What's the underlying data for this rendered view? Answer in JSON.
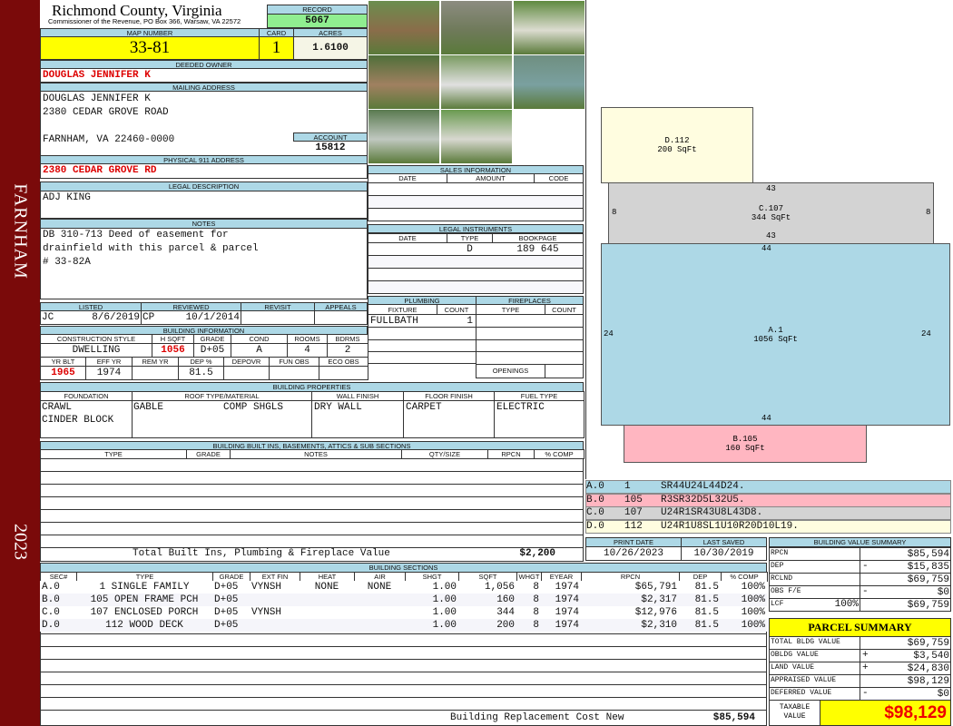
{
  "sidebar": {
    "city": "FARNHAM",
    "year": "2023",
    "color": "#7a0a0a"
  },
  "header": {
    "title": "Richmond County, Virginia",
    "subtitle": "Commissioner of the Revenue, PO Box 366, Warsaw, VA 22572",
    "record_label": "RECORD",
    "record": "5067"
  },
  "parcel": {
    "map_label": "MAP NUMBER",
    "map": "33-81",
    "card_label": "CARD",
    "card": "1",
    "acres_label": "ACRES",
    "acres": "1.6100"
  },
  "owner": {
    "label": "DEEDED OWNER",
    "name": "DOUGLAS JENNIFER K"
  },
  "mailing": {
    "label": "MAILING ADDRESS",
    "lines": [
      "DOUGLAS JENNIFER K",
      "2380 CEDAR GROVE ROAD",
      "FARNHAM, VA 22460-0000"
    ],
    "account_label": "ACCOUNT",
    "account": "15812"
  },
  "physical": {
    "label": "PHYSICAL 911 ADDRESS",
    "address": "2380 CEDAR GROVE RD"
  },
  "legal": {
    "label": "LEGAL DESCRIPTION",
    "value": "ADJ KING"
  },
  "notes": {
    "label": "NOTES",
    "lines": [
      "DB 310-713 Deed of easement for",
      "drainfield with this parcel & parcel",
      "# 33-82A"
    ]
  },
  "listing": {
    "headers": [
      "LISTED",
      "REVIEWED",
      "REVISIT",
      "APPEALS"
    ],
    "listed_by": "JC",
    "listed_date": "8/6/2019",
    "reviewed_by": "CP",
    "reviewed_date": "10/1/2014"
  },
  "building_info": {
    "label": "BUILDING INFORMATION",
    "headers1": [
      "CONSTRUCTION STYLE",
      "H SQFT",
      "GRADE",
      "COND",
      "ROOMS",
      "BDRMS"
    ],
    "values1": [
      "DWELLING",
      "1056",
      "D+05",
      "A",
      "4",
      "2"
    ],
    "headers2": [
      "YR BLT",
      "EFF YR",
      "REM YR",
      "DEP %",
      "DEPOVR",
      "FUN OBS",
      "ECO OBS"
    ],
    "values2": [
      "1965",
      "1974",
      "",
      "81.5",
      "",
      "",
      ""
    ]
  },
  "sales": {
    "label": "SALES INFORMATION",
    "headers": [
      "DATE",
      "AMOUNT",
      "CODE"
    ]
  },
  "instruments": {
    "label": "LEGAL INSTRUMENTS",
    "headers": [
      "DATE",
      "TYPE",
      "BOOKPAGE"
    ],
    "rows": [
      {
        "date": "",
        "type": "D",
        "bookpage": "189 645"
      }
    ]
  },
  "plumbing": {
    "label": "PLUMBING",
    "headers": [
      "FIXTURE",
      "COUNT"
    ],
    "rows": [
      {
        "fixture": "FULLBATH",
        "count": "1"
      }
    ]
  },
  "fireplaces": {
    "label": "FIREPLACES",
    "headers": [
      "TYPE",
      "COUNT"
    ],
    "openings_label": "OPENINGS"
  },
  "properties": {
    "label": "BUILDING PROPERTIES",
    "headers": [
      "FOUNDATION",
      "ROOF TYPE/MATERIAL",
      "WALL FINISH",
      "FLOOR FINISH",
      "FUEL TYPE"
    ],
    "foundation": [
      "CRAWL",
      "CINDER BLOCK"
    ],
    "roof_type": "GABLE",
    "roof_material": "COMP SHGLS",
    "wall": "DRY WALL",
    "floor": "CARPET",
    "fuel": "ELECTRIC"
  },
  "builtins": {
    "label": "BUILDING BUILT INS, BASEMENTS, ATTICS & SUB SECTIONS",
    "headers": [
      "TYPE",
      "GRADE",
      "NOTES",
      "QTY/SIZE",
      "RPCN",
      "% COMP"
    ],
    "total_label": "Total Built Ins, Plumbing & Fireplace Value",
    "total": "$2,200"
  },
  "sections": {
    "label": "BUILDING SECTIONS",
    "headers": [
      "SEC#",
      "TYPE",
      "GRADE",
      "EXT FIN",
      "HEAT",
      "AIR",
      "SHGT",
      "SQFT",
      "WHGT",
      "EYEAR",
      "RPCN",
      "DEP",
      "% COMP"
    ],
    "rows": [
      [
        "A.0",
        "1 SINGLE FAMILY",
        "D+05",
        "VYNSH",
        "NONE",
        "NONE",
        "1.00",
        "1,056",
        "8",
        "1974",
        "$65,791",
        "81.5",
        "100%"
      ],
      [
        "B.0",
        "105 OPEN FRAME PCH",
        "D+05",
        "",
        "",
        "",
        "1.00",
        "160",
        "8",
        "1974",
        "$2,317",
        "81.5",
        "100%"
      ],
      [
        "C.0",
        "107 ENCLOSED PORCH",
        "D+05",
        "VYNSH",
        "",
        "",
        "1.00",
        "344",
        "8",
        "1974",
        "$12,976",
        "81.5",
        "100%"
      ],
      [
        "D.0",
        "112 WOOD DECK",
        "D+05",
        "",
        "",
        "",
        "1.00",
        "200",
        "8",
        "1974",
        "$2,310",
        "81.5",
        "100%"
      ]
    ],
    "replacement_label": "Building Replacement Cost New",
    "replacement": "$85,594"
  },
  "sketch": {
    "areas": [
      {
        "id": "D.112",
        "sqft": "200 SqFt",
        "color": "#fffde0"
      },
      {
        "id": "C.107",
        "sqft": "344 SqFt",
        "color": "#d3d3d3"
      },
      {
        "id": "A.1",
        "sqft": "1056 SqFt",
        "color": "#add8e6"
      },
      {
        "id": "B.105",
        "sqft": "160 SqFt",
        "color": "#ffb6c1"
      }
    ],
    "dims": [
      "43",
      "43",
      "8",
      "8",
      "44",
      "24",
      "24",
      "44"
    ],
    "codes": [
      {
        "sec": "A.0",
        "num": "1",
        "code": "SR44U24L44D24.",
        "color": "#add8e6"
      },
      {
        "sec": "B.0",
        "num": "105",
        "code": "R3SR32D5L32U5.",
        "color": "#ffb6c1"
      },
      {
        "sec": "C.0",
        "num": "107",
        "code": "U24R1SR43U8L43D8.",
        "color": "#d3d3d3"
      },
      {
        "sec": "D.0",
        "num": "112",
        "code": "U24R1U8SL1U10R20D10L19.",
        "color": "#fffde0"
      }
    ]
  },
  "dates": {
    "print_label": "PRINT DATE",
    "print": "10/26/2023",
    "saved_label": "LAST SAVED",
    "saved": "10/30/2019"
  },
  "value_summary": {
    "label": "BUILDING VALUE SUMMARY",
    "rows": [
      {
        "label": "RPCN",
        "sign": "",
        "value": "$85,594"
      },
      {
        "label": "DEP",
        "sign": "-",
        "value": "$15,835"
      },
      {
        "label": "RCLND",
        "sign": "",
        "value": "$69,759"
      },
      {
        "label": "OBS F/E",
        "sign": "-",
        "value": "$0"
      },
      {
        "label": "LCF",
        "pct": "100%",
        "sign": "",
        "value": "$69,759"
      }
    ]
  },
  "parcel_summary": {
    "label": "PARCEL SUMMARY",
    "rows": [
      {
        "label": "TOTAL BLDG VALUE",
        "sign": "",
        "value": "$69,759"
      },
      {
        "label": "OBLDG VALUE",
        "sign": "+",
        "value": "$3,540"
      },
      {
        "label": "LAND VALUE",
        "sign": "+",
        "value": "$24,830"
      },
      {
        "label": "APPRAISED VALUE",
        "sign": "",
        "value": "$98,129"
      },
      {
        "label": "DEFERRED VALUE",
        "sign": "-",
        "value": "$0"
      }
    ],
    "taxable_label": "TAXABLE VALUE",
    "taxable": "$98,129"
  }
}
